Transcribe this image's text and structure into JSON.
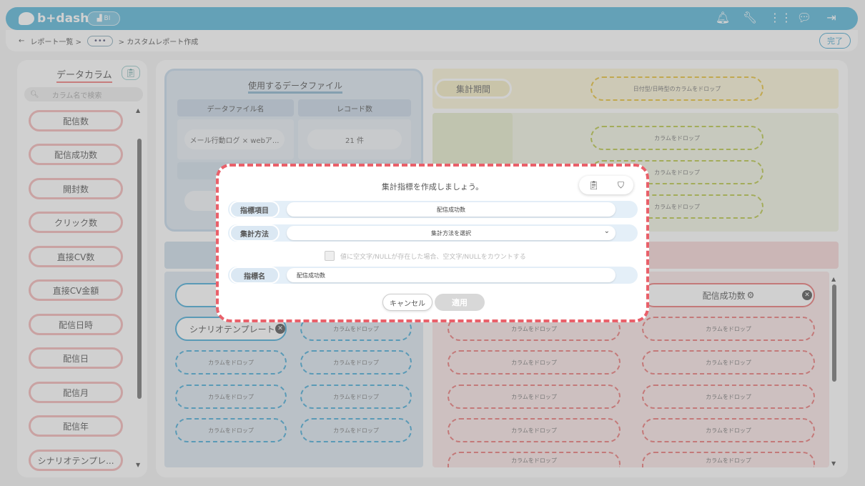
{
  "header": {
    "logo_text": "b+dash",
    "bi_badge": "BI",
    "icons": [
      "bell-icon",
      "wrench-icon",
      "grid-icon",
      "chat-icon",
      "logout-icon"
    ]
  },
  "breadcrumb": {
    "back": "←",
    "report_list": "レポート一覧 >",
    "ellipsis": "•••",
    "current": "> カスタムレポート作成",
    "done_button": "完了"
  },
  "sidebar": {
    "title": "データカラム",
    "search_placeholder": "カラム名で検索",
    "items": [
      "配信数",
      "配信成功数",
      "開封数",
      "クリック数",
      "直接CV数",
      "直接CV金額",
      "配信日時",
      "配信日",
      "配信月",
      "配信年",
      "シナリオテンプレ..."
    ]
  },
  "datafile": {
    "title": "使用するデータファイル",
    "col_name": "データファイル名",
    "col_records": "レコード数",
    "file_name": "メール行動ログ × webア...",
    "record_count": "21 件"
  },
  "period": {
    "label": "集計期間",
    "drop_date": "日付型/日時型のカラムをドロップ"
  },
  "drops": {
    "column_drop": "カラムをドロップ"
  },
  "rows_area": {
    "chip_scenario": "シナリオテンプレート"
  },
  "metrics_area": {
    "chip_success": "配信成功数"
  },
  "modal": {
    "title": "集計指標を作成しましょう。",
    "field_item_label": "指標項目",
    "field_item_value": "配信成功数",
    "field_method_label": "集計方法",
    "field_method_value": "集計方法を選択",
    "checkbox_label": "値に空文字/NULLが存在した場合、空文字/NULLをカウントする",
    "field_name_label": "指標名",
    "field_name_value": "配信成功数",
    "cancel": "キャンセル",
    "apply": "適用"
  },
  "colors": {
    "header_blue": "#5ab7d9",
    "modal_border": "#e9606a"
  }
}
